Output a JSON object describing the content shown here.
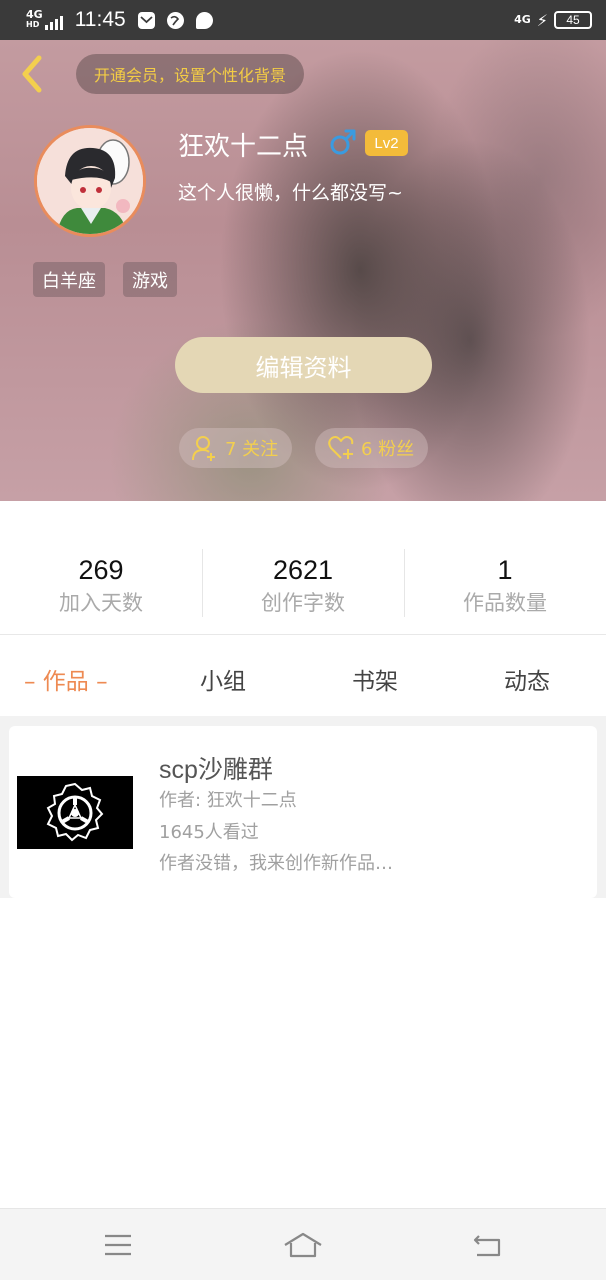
{
  "status_bar": {
    "network": "4G",
    "network_sub": "HD",
    "time": "11:45",
    "right_network": "4G",
    "battery": "45",
    "icons": [
      "signal-icon",
      "mail-icon",
      "browser-icon",
      "chat-icon",
      "charging-icon",
      "battery-icon"
    ]
  },
  "header": {
    "vip_promo": "开通会员，设置个性化背景",
    "username": "狂欢十二点",
    "gender_symbol": "♂",
    "level": "Lv2",
    "signature": "这个人很懒，什么都没写~",
    "tags": [
      "白羊座",
      "游戏"
    ],
    "edit_button": "编辑资料",
    "following_label": "7 关注",
    "followers_label": "6 粉丝"
  },
  "stats": [
    {
      "value": "269",
      "label": "加入天数"
    },
    {
      "value": "2621",
      "label": "创作字数"
    },
    {
      "value": "1",
      "label": "作品数量"
    }
  ],
  "tabs": [
    {
      "label": "– 作品 –",
      "active": true
    },
    {
      "label": "小组",
      "active": false
    },
    {
      "label": "书架",
      "active": false
    },
    {
      "label": "动态",
      "active": false
    }
  ],
  "works": [
    {
      "title": "scp沙雕群",
      "author": "作者: 狂欢十二点",
      "views": "1645人看过",
      "description": "作者没错，我来创作新作品…"
    }
  ],
  "colors": {
    "accent_orange": "#ee8a52",
    "vip_yellow": "#f3cc45",
    "level_badge": "#f3bb3a",
    "edit_button": "#e4d7b5",
    "male_blue": "#3a9be0"
  }
}
